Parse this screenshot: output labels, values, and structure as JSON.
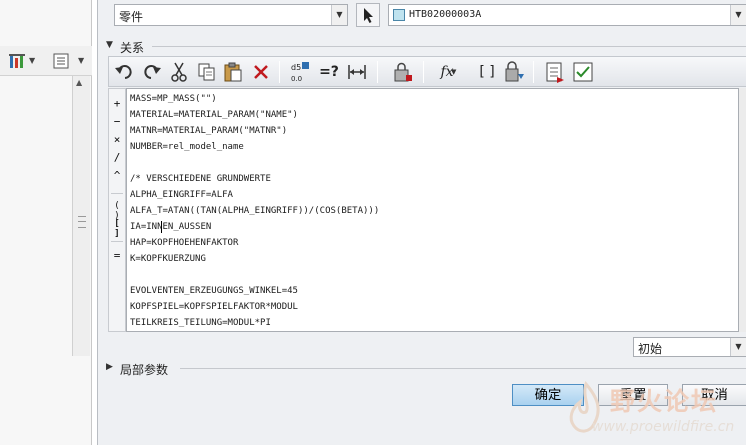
{
  "object_type_select": {
    "value": "零件"
  },
  "model_select": {
    "value": "HTB02000003A"
  },
  "relations_section": {
    "label": "关系"
  },
  "toolbar": {
    "icons": [
      "undo-icon",
      "redo-icon",
      "cut-icon",
      "copy-icon",
      "paste-icon",
      "delete-icon",
      "units-switch-icon",
      "evaluate-icon",
      "measure-icon",
      "verify-icon",
      "function-icon",
      "parameters-icon",
      "sort-icon",
      "show-icon",
      "check-icon"
    ],
    "evaluate_label": "=?",
    "function_label": "fx",
    "parameters_label": "[ ]"
  },
  "operators": [
    "+",
    "−",
    "×",
    "/",
    "^",
    "( )",
    "[ ]",
    "="
  ],
  "editor": {
    "lines": [
      "MASS=MP_MASS(\"\")",
      "MATERIAL=MATERIAL_PARAM(\"NAME\")",
      "MATNR=MATERIAL_PARAM(\"MATNR\")",
      "NUMBER=rel_model_name",
      "",
      "/* VERSCHIEDENE GRUNDWERTE",
      "ALPHA_EINGRIFF=ALFA",
      "ALFA_T=ATAN((TAN(ALPHA_EINGRIFF))/(COS(BETA)))",
      "IA=INNEN_AUSSEN",
      "HAP=KOPFHOEHENFAKTOR",
      "K=KOPFKUERZUNG",
      "",
      "EVOLVENTEN_ERZEUGUNGS_WINKEL=45",
      "KOPFSPIEL=KOPFSPIELFAKTOR*MODUL",
      "TEILKREIS_TEILUNG=MODUL*PI"
    ]
  },
  "units_select": {
    "value": "初始"
  },
  "local_params_section": {
    "label": "局部参数"
  },
  "buttons": {
    "ok": "确定",
    "reset": "重置",
    "cancel": "取消"
  },
  "watermark": {
    "title": "野火论坛",
    "url": "www.proewildfire.cn"
  }
}
